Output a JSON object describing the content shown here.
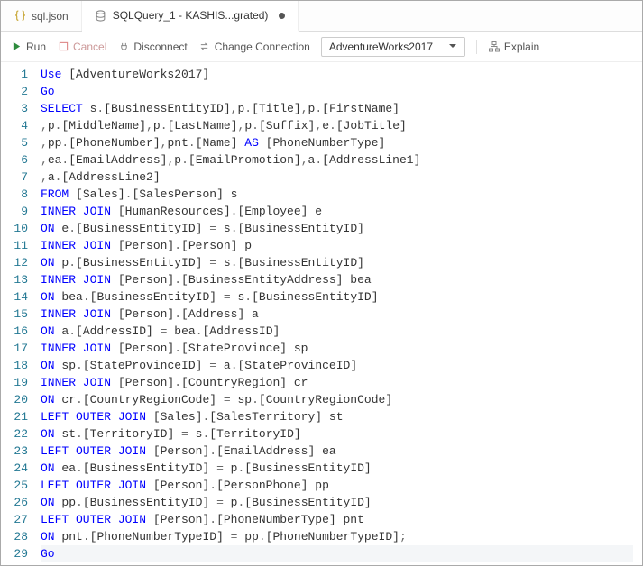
{
  "tabs": [
    {
      "label": "sql.json",
      "icon": "braces-icon",
      "active": false,
      "dirty": false
    },
    {
      "label": "SQLQuery_1 - KASHIS...grated)",
      "icon": "db-icon",
      "active": true,
      "dirty": true
    }
  ],
  "toolbar": {
    "run": "Run",
    "cancel": "Cancel",
    "disconnect": "Disconnect",
    "change_connection": "Change Connection",
    "connection": "AdventureWorks2017",
    "explain": "Explain"
  },
  "code_lines": [
    [
      {
        "t": "Use",
        "c": "kw"
      },
      {
        "t": " [AdventureWorks2017]",
        "c": ""
      }
    ],
    [
      {
        "t": "Go",
        "c": "kw"
      }
    ],
    [
      {
        "t": "SELECT",
        "c": "kw"
      },
      {
        "t": " s",
        "c": ""
      },
      {
        "t": ".",
        "c": "op"
      },
      {
        "t": "[BusinessEntityID]",
        "c": ""
      },
      {
        "t": ",",
        "c": "op"
      },
      {
        "t": "p",
        "c": ""
      },
      {
        "t": ".",
        "c": "op"
      },
      {
        "t": "[Title]",
        "c": ""
      },
      {
        "t": ",",
        "c": "op"
      },
      {
        "t": "p",
        "c": ""
      },
      {
        "t": ".",
        "c": "op"
      },
      {
        "t": "[FirstName]",
        "c": ""
      }
    ],
    [
      {
        "t": ",",
        "c": "op"
      },
      {
        "t": "p",
        "c": ""
      },
      {
        "t": ".",
        "c": "op"
      },
      {
        "t": "[MiddleName]",
        "c": ""
      },
      {
        "t": ",",
        "c": "op"
      },
      {
        "t": "p",
        "c": ""
      },
      {
        "t": ".",
        "c": "op"
      },
      {
        "t": "[LastName]",
        "c": ""
      },
      {
        "t": ",",
        "c": "op"
      },
      {
        "t": "p",
        "c": ""
      },
      {
        "t": ".",
        "c": "op"
      },
      {
        "t": "[Suffix]",
        "c": ""
      },
      {
        "t": ",",
        "c": "op"
      },
      {
        "t": "e",
        "c": ""
      },
      {
        "t": ".",
        "c": "op"
      },
      {
        "t": "[JobTitle]",
        "c": ""
      }
    ],
    [
      {
        "t": ",",
        "c": "op"
      },
      {
        "t": "pp",
        "c": ""
      },
      {
        "t": ".",
        "c": "op"
      },
      {
        "t": "[PhoneNumber]",
        "c": ""
      },
      {
        "t": ",",
        "c": "op"
      },
      {
        "t": "pnt",
        "c": ""
      },
      {
        "t": ".",
        "c": "op"
      },
      {
        "t": "[Name] ",
        "c": ""
      },
      {
        "t": "AS",
        "c": "kw"
      },
      {
        "t": " [PhoneNumberType]",
        "c": ""
      }
    ],
    [
      {
        "t": ",",
        "c": "op"
      },
      {
        "t": "ea",
        "c": ""
      },
      {
        "t": ".",
        "c": "op"
      },
      {
        "t": "[EmailAddress]",
        "c": ""
      },
      {
        "t": ",",
        "c": "op"
      },
      {
        "t": "p",
        "c": ""
      },
      {
        "t": ".",
        "c": "op"
      },
      {
        "t": "[EmailPromotion]",
        "c": ""
      },
      {
        "t": ",",
        "c": "op"
      },
      {
        "t": "a",
        "c": ""
      },
      {
        "t": ".",
        "c": "op"
      },
      {
        "t": "[AddressLine1]",
        "c": ""
      }
    ],
    [
      {
        "t": ",",
        "c": "op"
      },
      {
        "t": "a",
        "c": ""
      },
      {
        "t": ".",
        "c": "op"
      },
      {
        "t": "[AddressLine2]",
        "c": ""
      }
    ],
    [
      {
        "t": "FROM",
        "c": "kw"
      },
      {
        "t": " [Sales]",
        "c": ""
      },
      {
        "t": ".",
        "c": "op"
      },
      {
        "t": "[SalesPerson] s",
        "c": ""
      }
    ],
    [
      {
        "t": "INNER JOIN",
        "c": "kw"
      },
      {
        "t": " [HumanResources]",
        "c": ""
      },
      {
        "t": ".",
        "c": "op"
      },
      {
        "t": "[Employee] e",
        "c": ""
      }
    ],
    [
      {
        "t": "ON",
        "c": "kw"
      },
      {
        "t": " e",
        "c": ""
      },
      {
        "t": ".",
        "c": "op"
      },
      {
        "t": "[BusinessEntityID] ",
        "c": ""
      },
      {
        "t": "=",
        "c": "op"
      },
      {
        "t": " s",
        "c": ""
      },
      {
        "t": ".",
        "c": "op"
      },
      {
        "t": "[BusinessEntityID]",
        "c": ""
      }
    ],
    [
      {
        "t": "INNER JOIN",
        "c": "kw"
      },
      {
        "t": " [Person]",
        "c": ""
      },
      {
        "t": ".",
        "c": "op"
      },
      {
        "t": "[Person] p",
        "c": ""
      }
    ],
    [
      {
        "t": "ON",
        "c": "kw"
      },
      {
        "t": " p",
        "c": ""
      },
      {
        "t": ".",
        "c": "op"
      },
      {
        "t": "[BusinessEntityID] ",
        "c": ""
      },
      {
        "t": "=",
        "c": "op"
      },
      {
        "t": " s",
        "c": ""
      },
      {
        "t": ".",
        "c": "op"
      },
      {
        "t": "[BusinessEntityID]",
        "c": ""
      }
    ],
    [
      {
        "t": "INNER JOIN",
        "c": "kw"
      },
      {
        "t": " [Person]",
        "c": ""
      },
      {
        "t": ".",
        "c": "op"
      },
      {
        "t": "[BusinessEntityAddress] bea",
        "c": ""
      }
    ],
    [
      {
        "t": "ON",
        "c": "kw"
      },
      {
        "t": " bea",
        "c": ""
      },
      {
        "t": ".",
        "c": "op"
      },
      {
        "t": "[BusinessEntityID] ",
        "c": ""
      },
      {
        "t": "=",
        "c": "op"
      },
      {
        "t": " s",
        "c": ""
      },
      {
        "t": ".",
        "c": "op"
      },
      {
        "t": "[BusinessEntityID]",
        "c": ""
      }
    ],
    [
      {
        "t": "INNER JOIN",
        "c": "kw"
      },
      {
        "t": " [Person]",
        "c": ""
      },
      {
        "t": ".",
        "c": "op"
      },
      {
        "t": "[Address] a",
        "c": ""
      }
    ],
    [
      {
        "t": "ON",
        "c": "kw"
      },
      {
        "t": " a",
        "c": ""
      },
      {
        "t": ".",
        "c": "op"
      },
      {
        "t": "[AddressID] ",
        "c": ""
      },
      {
        "t": "=",
        "c": "op"
      },
      {
        "t": " bea",
        "c": ""
      },
      {
        "t": ".",
        "c": "op"
      },
      {
        "t": "[AddressID]",
        "c": ""
      }
    ],
    [
      {
        "t": "INNER JOIN",
        "c": "kw"
      },
      {
        "t": " [Person]",
        "c": ""
      },
      {
        "t": ".",
        "c": "op"
      },
      {
        "t": "[StateProvince] sp",
        "c": ""
      }
    ],
    [
      {
        "t": "ON",
        "c": "kw"
      },
      {
        "t": " sp",
        "c": ""
      },
      {
        "t": ".",
        "c": "op"
      },
      {
        "t": "[StateProvinceID] ",
        "c": ""
      },
      {
        "t": "=",
        "c": "op"
      },
      {
        "t": " a",
        "c": ""
      },
      {
        "t": ".",
        "c": "op"
      },
      {
        "t": "[StateProvinceID]",
        "c": ""
      }
    ],
    [
      {
        "t": "INNER JOIN",
        "c": "kw"
      },
      {
        "t": " [Person]",
        "c": ""
      },
      {
        "t": ".",
        "c": "op"
      },
      {
        "t": "[CountryRegion] cr",
        "c": ""
      }
    ],
    [
      {
        "t": "ON",
        "c": "kw"
      },
      {
        "t": " cr",
        "c": ""
      },
      {
        "t": ".",
        "c": "op"
      },
      {
        "t": "[CountryRegionCode] ",
        "c": ""
      },
      {
        "t": "=",
        "c": "op"
      },
      {
        "t": " sp",
        "c": ""
      },
      {
        "t": ".",
        "c": "op"
      },
      {
        "t": "[CountryRegionCode]",
        "c": ""
      }
    ],
    [
      {
        "t": "LEFT OUTER JOIN",
        "c": "kw"
      },
      {
        "t": " [Sales]",
        "c": ""
      },
      {
        "t": ".",
        "c": "op"
      },
      {
        "t": "[SalesTerritory] st",
        "c": ""
      }
    ],
    [
      {
        "t": "ON",
        "c": "kw"
      },
      {
        "t": " st",
        "c": ""
      },
      {
        "t": ".",
        "c": "op"
      },
      {
        "t": "[TerritoryID] ",
        "c": ""
      },
      {
        "t": "=",
        "c": "op"
      },
      {
        "t": " s",
        "c": ""
      },
      {
        "t": ".",
        "c": "op"
      },
      {
        "t": "[TerritoryID]",
        "c": ""
      }
    ],
    [
      {
        "t": "LEFT OUTER JOIN",
        "c": "kw"
      },
      {
        "t": " [Person]",
        "c": ""
      },
      {
        "t": ".",
        "c": "op"
      },
      {
        "t": "[EmailAddress] ea",
        "c": ""
      }
    ],
    [
      {
        "t": "ON",
        "c": "kw"
      },
      {
        "t": " ea",
        "c": ""
      },
      {
        "t": ".",
        "c": "op"
      },
      {
        "t": "[BusinessEntityID] ",
        "c": ""
      },
      {
        "t": "=",
        "c": "op"
      },
      {
        "t": " p",
        "c": ""
      },
      {
        "t": ".",
        "c": "op"
      },
      {
        "t": "[BusinessEntityID]",
        "c": ""
      }
    ],
    [
      {
        "t": "LEFT OUTER JOIN",
        "c": "kw"
      },
      {
        "t": " [Person]",
        "c": ""
      },
      {
        "t": ".",
        "c": "op"
      },
      {
        "t": "[PersonPhone] pp",
        "c": ""
      }
    ],
    [
      {
        "t": "ON",
        "c": "kw"
      },
      {
        "t": " pp",
        "c": ""
      },
      {
        "t": ".",
        "c": "op"
      },
      {
        "t": "[BusinessEntityID] ",
        "c": ""
      },
      {
        "t": "=",
        "c": "op"
      },
      {
        "t": " p",
        "c": ""
      },
      {
        "t": ".",
        "c": "op"
      },
      {
        "t": "[BusinessEntityID]",
        "c": ""
      }
    ],
    [
      {
        "t": "LEFT OUTER JOIN",
        "c": "kw"
      },
      {
        "t": " [Person]",
        "c": ""
      },
      {
        "t": ".",
        "c": "op"
      },
      {
        "t": "[PhoneNumberType] pnt",
        "c": ""
      }
    ],
    [
      {
        "t": "ON",
        "c": "kw"
      },
      {
        "t": " pnt",
        "c": ""
      },
      {
        "t": ".",
        "c": "op"
      },
      {
        "t": "[PhoneNumberTypeID] ",
        "c": ""
      },
      {
        "t": "=",
        "c": "op"
      },
      {
        "t": " pp",
        "c": ""
      },
      {
        "t": ".",
        "c": "op"
      },
      {
        "t": "[PhoneNumberTypeID]",
        "c": ""
      },
      {
        "t": ";",
        "c": "op"
      }
    ],
    [
      {
        "t": "Go",
        "c": "kw"
      }
    ]
  ],
  "current_line": 29
}
